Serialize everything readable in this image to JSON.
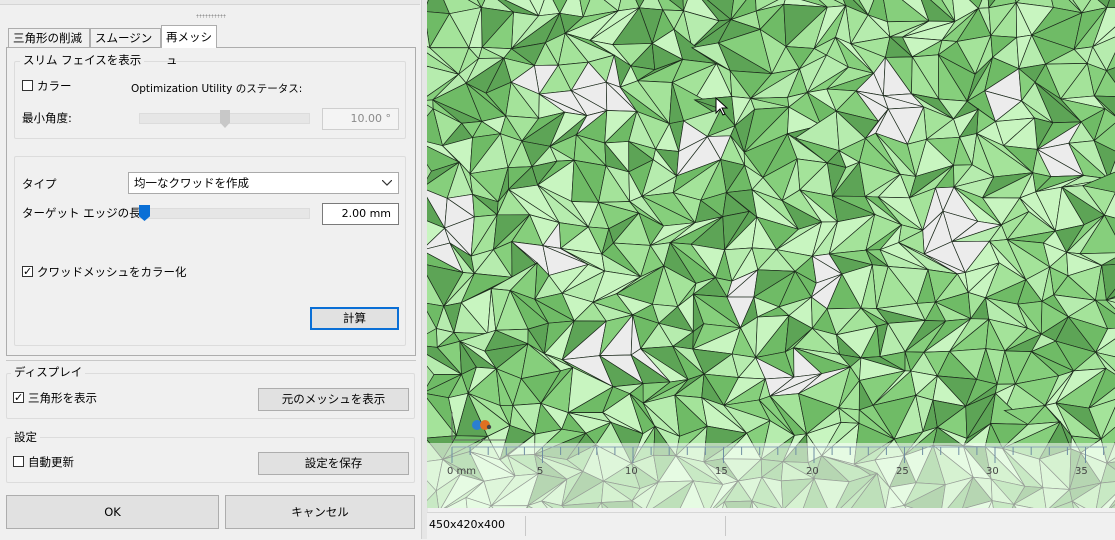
{
  "tabs": [
    {
      "label": "三角形の削減",
      "active": false
    },
    {
      "label": "スムージング",
      "active": false
    },
    {
      "label": "再メッシュ",
      "active": true
    }
  ],
  "slim_faces": {
    "title": "スリム フェイスを表示",
    "color_label": "カラー",
    "color_checked": false,
    "status_label": "Optimization Utility のステータス:",
    "min_angle_label": "最小角度:",
    "min_angle_value": "10.00 °",
    "min_angle_slider_fraction": 0.5
  },
  "remesh": {
    "type_label": "タイプ",
    "type_value": "均一なクワッドを作成",
    "target_edge_label": "ターゲット エッジの長さ",
    "target_edge_value": "2.00 mm",
    "target_edge_slider_fraction": 0.03,
    "color_quad_label": "クワッドメッシュをカラー化",
    "color_quad_checked": true,
    "compute_button": "計算"
  },
  "display": {
    "title": "ディスプレイ",
    "show_triangles_label": "三角形を表示",
    "show_triangles_checked": true,
    "show_original_button": "元のメッシュを表示"
  },
  "settings": {
    "title": "設定",
    "auto_update_label": "自動更新",
    "auto_update_checked": false,
    "save_button": "設定を保存"
  },
  "dialog": {
    "ok_button": "OK",
    "cancel_button": "キャンセル"
  },
  "viewport": {
    "ruler_labels": [
      "0 mm",
      "5",
      "10",
      "15",
      "20",
      "25",
      "30",
      "35"
    ],
    "mesh_colors": [
      "#c8f5c0",
      "#a4e39a",
      "#86cf7c",
      "#6fbb66",
      "#b6ecae",
      "#5da456"
    ],
    "hole_color": "#ececec"
  },
  "status": {
    "dimensions": "450x420x400"
  }
}
